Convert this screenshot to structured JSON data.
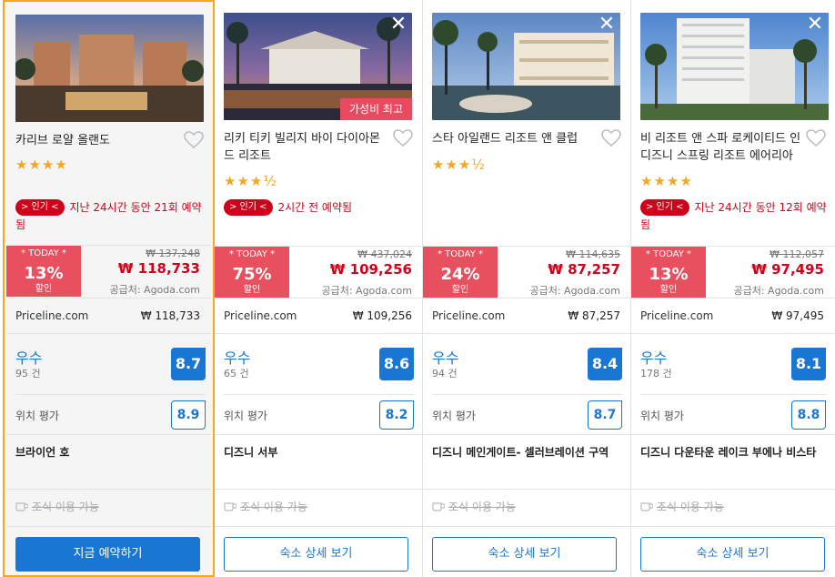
{
  "cards": [
    {
      "name": "카리브 로얄 올랜도",
      "stars": "★★★★",
      "popular_badge": "> 인기 <",
      "popular_text": "지난 24시간 동안 21회 예약됨",
      "today_label": "* TODAY *",
      "discount": "13%",
      "discount_label": "할인",
      "original_price": "₩ 137,248",
      "deal_price": "₩ 118,733",
      "supplier": "공급처: Agoda.com",
      "provider": "Priceline.com",
      "provider_price": "₩  118,733",
      "rating_word": "우수",
      "rating_count": "95 건",
      "score": "8.7",
      "location_label": "위치 평가",
      "location_score": "8.9",
      "area": "브라이언 호",
      "breakfast": "조식 이용 가능",
      "button": "지금 예약하기"
    },
    {
      "name": "리키 티키 빌리지 바이 다이아몬드 리조트",
      "stars": "★★★½",
      "value_badge": "가성비 최고",
      "popular_badge": "> 인기 <",
      "popular_text": "2시간 전 예약됨",
      "today_label": "* TODAY *",
      "discount": "75%",
      "discount_label": "할인",
      "original_price": "₩ 437,024",
      "deal_price": "₩ 109,256",
      "supplier": "공급처: Agoda.com",
      "provider": "Priceline.com",
      "provider_price": "₩  109,256",
      "rating_word": "우수",
      "rating_count": "65 건",
      "score": "8.6",
      "location_label": "위치 평가",
      "location_score": "8.2",
      "area": "디즈니 서부",
      "breakfast": "조식 이용 가능",
      "button": "숙소 상세 보기"
    },
    {
      "name": "스타 아일랜드 리조트 앤 클럽",
      "stars": "★★★½",
      "today_label": "* TODAY *",
      "discount": "24%",
      "discount_label": "할인",
      "original_price": "₩ 114,635",
      "deal_price": "₩ 87,257",
      "supplier": "공급처: Agoda.com",
      "provider": "Priceline.com",
      "provider_price": "₩  87,257",
      "rating_word": "우수",
      "rating_count": "94 건",
      "score": "8.4",
      "location_label": "위치 평가",
      "location_score": "8.7",
      "area": "디즈니 메인게이트- 셀러브레이션 구역",
      "breakfast": "조식 이용 가능",
      "button": "숙소 상세 보기"
    },
    {
      "name": "비 리조트 앤 스파 로케이티드 인 디즈니 스프링 리조트 에어리아",
      "stars": "★★★★",
      "popular_badge": "> 인기 <",
      "popular_text": "지난 24시간 동안 12회 예약됨",
      "today_label": "* TODAY *",
      "discount": "13%",
      "discount_label": "할인",
      "original_price": "₩ 112,057",
      "deal_price": "₩ 97,495",
      "supplier": "공급처: Agoda.com",
      "provider": "Priceline.com",
      "provider_price": "₩  97,495",
      "rating_word": "우수",
      "rating_count": "178 건",
      "score": "8.1",
      "location_label": "위치 평가",
      "location_score": "8.8",
      "area": "디즈니 다운타운 레이크 부에나 비스타",
      "breakfast": "조식 이용 가능",
      "button": "숙소 상세 보기"
    }
  ],
  "close_glyph": "✕",
  "colors": {
    "accent_blue": "#1976d2",
    "deal_red": "#e8505f",
    "popular_red": "#d0021b",
    "selected_border": "#f5a623",
    "star": "#f5a623"
  }
}
